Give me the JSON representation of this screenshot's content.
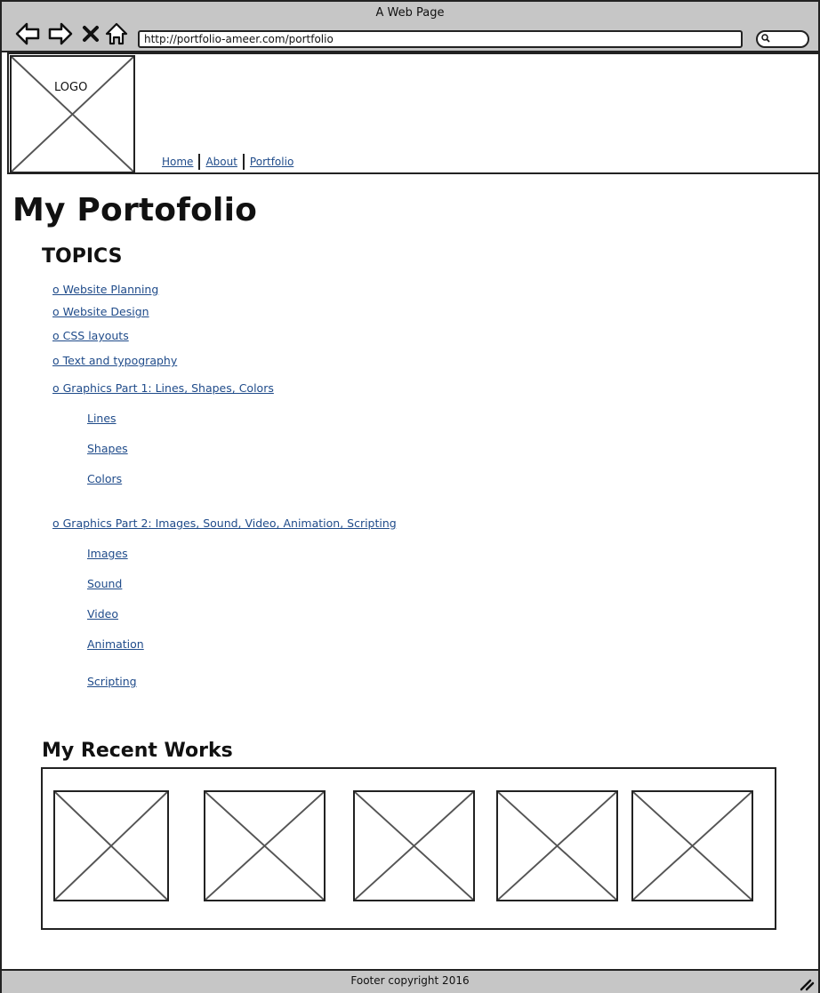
{
  "window": {
    "title": "A Web Page"
  },
  "browser": {
    "url": "http://portfolio-ameer.com/portfolio"
  },
  "header": {
    "logo_text": "LOGO",
    "nav": [
      {
        "label": "Home"
      },
      {
        "label": "About"
      },
      {
        "label": "Portfolio"
      }
    ]
  },
  "main": {
    "title": "My Portofolio",
    "topics_heading": "TOPICS",
    "topics": [
      {
        "label": "o Website Planning"
      },
      {
        "label": "o Website Design"
      },
      {
        "label": "o CSS layouts"
      },
      {
        "label": "o Text and typography"
      },
      {
        "label": "o Graphics Part 1: Lines, Shapes, Colors",
        "children": [
          {
            "label": " Lines"
          },
          {
            "label": " Shapes"
          },
          {
            "label": " Colors"
          }
        ]
      },
      {
        "label": "o Graphics Part 2: Images, Sound, Video, Animation, Scripting",
        "children": [
          {
            "label": " Images"
          },
          {
            "label": " Sound"
          },
          {
            "label": " Video"
          },
          {
            "label": " Animation"
          },
          {
            "label": " Scripting"
          }
        ]
      }
    ],
    "works_heading": "My Recent Works"
  },
  "footer": {
    "text": "Footer copyright 2016"
  },
  "colors": {
    "link": "#1f4b8a",
    "chrome": "#c6c6c6",
    "stroke": "#222222"
  }
}
